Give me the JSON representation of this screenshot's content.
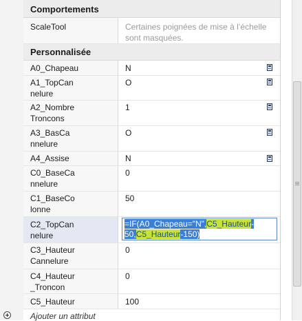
{
  "sections": {
    "behaviors": {
      "title": "Comportements"
    },
    "custom": {
      "title": "Personnalisée"
    }
  },
  "behaviors_rows": [
    {
      "name": "ScaleTool",
      "value": "Certaines poignées de mise à l’échelle sont masquées."
    }
  ],
  "rows": [
    {
      "name": "A0_Chapeau",
      "value": "N"
    },
    {
      "name": "A1_TopCannelure",
      "value": "O"
    },
    {
      "name": "A2_NombreTroncons",
      "value": "1"
    },
    {
      "name": "A3_BasCannelure",
      "value": "O"
    },
    {
      "name": "A4_Assise",
      "value": "N"
    },
    {
      "name": "C0_BaseCannelure",
      "value": "0"
    },
    {
      "name": "C1_BaseColonne",
      "value": "50"
    },
    {
      "name": "C2_TopCannelure",
      "value": ""
    },
    {
      "name": "C3_Hauteur Cannelure",
      "value": "0"
    },
    {
      "name": "C4_Hauteur_Troncon",
      "value": "0"
    },
    {
      "name": "C5_Hauteur",
      "value": "100"
    }
  ],
  "formula": {
    "p1": "=IF(A0_Chapeau=\"N\",",
    "ref1": "C5_Hauteur",
    "p2": "-",
    "p3": "50,",
    "ref2": "C5_Hauteur",
    "p4": "-150)"
  },
  "add_attribute": "Ajouter un attribut",
  "icons": {
    "calc": "calculator-icon",
    "add": "plus-circle-icon"
  }
}
